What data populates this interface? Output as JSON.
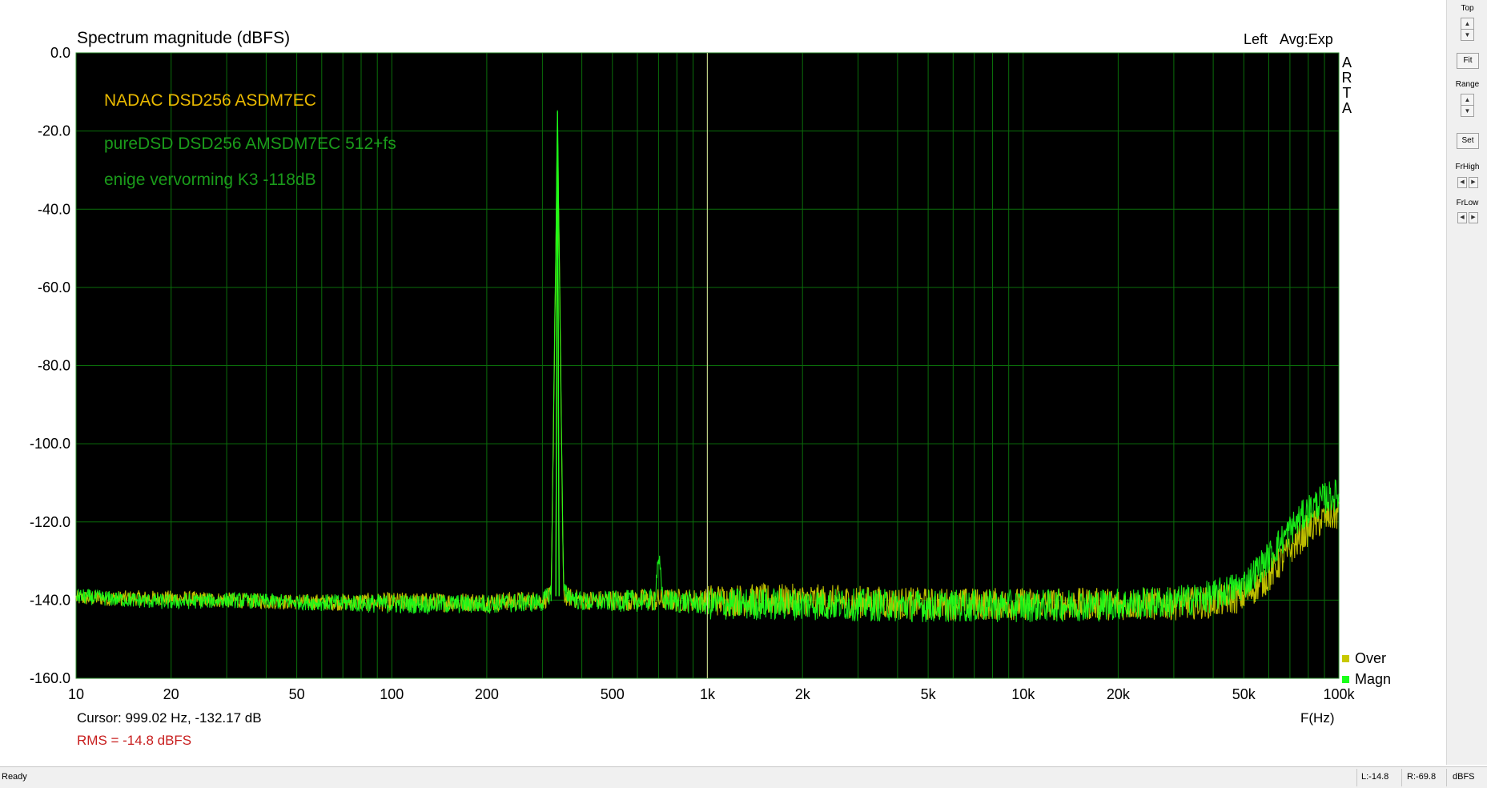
{
  "chart_data": {
    "type": "line",
    "title": "Spectrum magnitude (dBFS)",
    "channel": "Left",
    "averaging": "Avg:Exp",
    "brand_letters": [
      "A",
      "R",
      "T",
      "A"
    ],
    "xlabel": "F(Hz)",
    "x_scale": "log",
    "xlim": [
      10,
      100000
    ],
    "ylim": [
      -160,
      0
    ],
    "x_ticks": [
      {
        "value": 10,
        "label": "10"
      },
      {
        "value": 20,
        "label": "20"
      },
      {
        "value": 50,
        "label": "50"
      },
      {
        "value": 100,
        "label": "100"
      },
      {
        "value": 200,
        "label": "200"
      },
      {
        "value": 500,
        "label": "500"
      },
      {
        "value": 1000,
        "label": "1k"
      },
      {
        "value": 2000,
        "label": "2k"
      },
      {
        "value": 5000,
        "label": "5k"
      },
      {
        "value": 10000,
        "label": "10k"
      },
      {
        "value": 20000,
        "label": "20k"
      },
      {
        "value": 50000,
        "label": "50k"
      },
      {
        "value": 100000,
        "label": "100k"
      }
    ],
    "y_ticks": [
      {
        "value": 0,
        "label": "0.0"
      },
      {
        "value": -20,
        "label": "-20.0"
      },
      {
        "value": -40,
        "label": "-40.0"
      },
      {
        "value": -60,
        "label": "-60.0"
      },
      {
        "value": -80,
        "label": "-80.0"
      },
      {
        "value": -100,
        "label": "-100.0"
      },
      {
        "value": -120,
        "label": "-120.0"
      },
      {
        "value": -140,
        "label": "-140.0"
      },
      {
        "value": -160,
        "label": "-160.0"
      }
    ],
    "grid": true,
    "cursor_x": 999.02,
    "annotations": [
      {
        "text": "NADAC DSD256 ASDM7EC",
        "color": "#e8b800"
      },
      {
        "text": "pureDSD DSD256 AMSDM7EC 512+fs",
        "color": "#1a9a1a"
      },
      {
        "text": "enige vervorming K3 -118dB",
        "color": "#1a9a1a"
      }
    ],
    "legend_position": "bottom-right",
    "series": [
      {
        "name": "Over",
        "color": "#c8c800",
        "x": [
          10,
          15,
          20,
          30,
          50,
          100,
          200,
          300,
          320,
          335,
          350,
          400,
          700,
          1000,
          2000,
          5000,
          10000,
          20000,
          30000,
          40000,
          50000,
          60000,
          70000,
          80000,
          90000,
          100000
        ],
        "values": [
          -139.5,
          -139.5,
          -139.5,
          -140,
          -140.5,
          -140.5,
          -140.5,
          -140,
          -139,
          -18,
          -139,
          -140,
          -140,
          -140,
          -140,
          -141,
          -141,
          -141,
          -141,
          -140.5,
          -139,
          -134,
          -127,
          -122,
          -119,
          -118
        ],
        "band": [
          4,
          4,
          4,
          4,
          4,
          5,
          5,
          5,
          5,
          5,
          5,
          5,
          6,
          6,
          6,
          6,
          6,
          6,
          6,
          6,
          6,
          6,
          6,
          6,
          6,
          6
        ]
      },
      {
        "name": "Magn",
        "color": "#19ff19",
        "x": [
          10,
          15,
          20,
          30,
          50,
          100,
          200,
          300,
          320,
          335,
          350,
          400,
          680,
          700,
          720,
          1000,
          2000,
          5000,
          10000,
          20000,
          30000,
          40000,
          50000,
          60000,
          70000,
          80000,
          90000,
          100000
        ],
        "values": [
          -139,
          -140,
          -140.5,
          -140,
          -140.5,
          -141,
          -141,
          -140.5,
          -138,
          -15,
          -138,
          -140.5,
          -140,
          -128,
          -140,
          -141,
          -141,
          -141.5,
          -141.5,
          -141,
          -140.5,
          -139,
          -136,
          -129,
          -122,
          -117,
          -114,
          -113
        ],
        "band": [
          4,
          4,
          4,
          4,
          4,
          5,
          5,
          5,
          5,
          5,
          5,
          5,
          6,
          6,
          6,
          6,
          6,
          6,
          6,
          6,
          6,
          6,
          6,
          6,
          6,
          6,
          6,
          6
        ]
      }
    ]
  },
  "cursor_readout": "Cursor: 999.02 Hz, -132.17 dB",
  "rms_readout": "RMS =  -14.8 dBFS",
  "side_panel": {
    "top_label": "Top",
    "fit_label": "Fit",
    "range_label": "Range",
    "set_label": "Set",
    "frhigh_label": "FrHigh",
    "frlow_label": "FrLow"
  },
  "status_bar": {
    "ready": "Ready",
    "left_level": "L:-14.8",
    "right_level": "R:-69.8",
    "unit": "dBFS"
  },
  "colors": {
    "plot_bg": "#000000",
    "grid": "#0a6e0a",
    "cursor_line": "#e6e6a0",
    "rms_text": "#c81e1e"
  }
}
